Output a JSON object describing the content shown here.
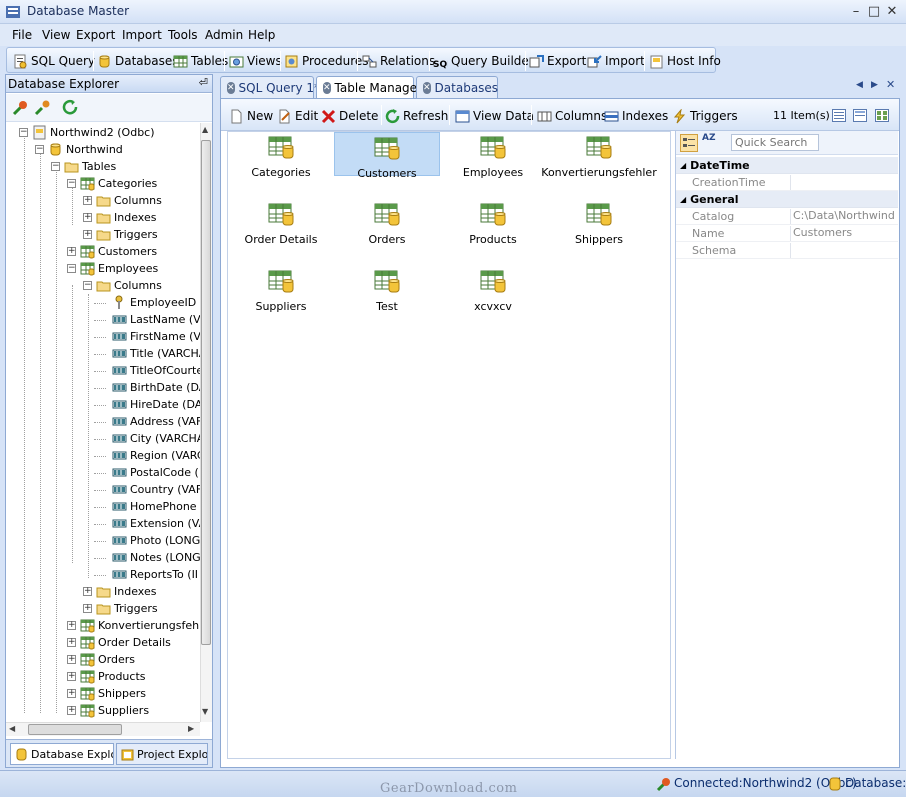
{
  "window": {
    "title": "Database Master"
  },
  "menu": [
    "File",
    "View",
    "Export",
    "Import",
    "Tools",
    "Admin",
    "Help"
  ],
  "toolbar": {
    "sql_query": "SQL Query",
    "databases": "Databases",
    "tables": "Tables",
    "views": "Views",
    "procedures": "Procedures",
    "relations": "Relations",
    "query_builder": "Query Builder",
    "export": "Export",
    "import": "Import",
    "host_info": "Host Info"
  },
  "explorer": {
    "title": "Database Explorer",
    "tree": [
      {
        "label": "Northwind2 (Odbc)",
        "icon": "connection-icon",
        "level": 0,
        "expander": "minus"
      },
      {
        "label": "Northwind",
        "icon": "database-icon",
        "level": 1,
        "expander": "minus"
      },
      {
        "label": "Tables",
        "icon": "folder-icon",
        "level": 2,
        "expander": "minus"
      },
      {
        "label": "Categories",
        "icon": "table-icon",
        "level": 3,
        "expander": "minus"
      },
      {
        "label": "Columns",
        "icon": "folder-icon",
        "level": 4,
        "expander": "plus"
      },
      {
        "label": "Indexes",
        "icon": "folder-icon",
        "level": 4,
        "expander": "plus"
      },
      {
        "label": "Triggers",
        "icon": "folder-icon",
        "level": 4,
        "expander": "plus"
      },
      {
        "label": "Customers",
        "icon": "table-icon",
        "level": 3,
        "expander": "plus"
      },
      {
        "label": "Employees",
        "icon": "table-icon",
        "level": 3,
        "expander": "minus"
      },
      {
        "label": "Columns",
        "icon": "folder-icon",
        "level": 4,
        "expander": "minus"
      },
      {
        "label": "EmployeeID (",
        "icon": "key-icon",
        "level": 5,
        "expander": ""
      },
      {
        "label": "LastName (VA",
        "icon": "column-icon",
        "level": 5,
        "expander": ""
      },
      {
        "label": "FirstName (VA",
        "icon": "column-icon",
        "level": 5,
        "expander": ""
      },
      {
        "label": "Title (VARCHA",
        "icon": "column-icon",
        "level": 5,
        "expander": ""
      },
      {
        "label": "TitleOfCourte",
        "icon": "column-icon",
        "level": 5,
        "expander": ""
      },
      {
        "label": "BirthDate (DA",
        "icon": "column-icon",
        "level": 5,
        "expander": ""
      },
      {
        "label": "HireDate (DA",
        "icon": "column-icon",
        "level": 5,
        "expander": ""
      },
      {
        "label": "Address (VAF",
        "icon": "column-icon",
        "level": 5,
        "expander": ""
      },
      {
        "label": "City (VARCHA",
        "icon": "column-icon",
        "level": 5,
        "expander": ""
      },
      {
        "label": "Region (VARC",
        "icon": "column-icon",
        "level": 5,
        "expander": ""
      },
      {
        "label": "PostalCode (",
        "icon": "column-icon",
        "level": 5,
        "expander": ""
      },
      {
        "label": "Country (VAF",
        "icon": "column-icon",
        "level": 5,
        "expander": ""
      },
      {
        "label": "HomePhone (",
        "icon": "column-icon",
        "level": 5,
        "expander": ""
      },
      {
        "label": "Extension (VA",
        "icon": "column-icon",
        "level": 5,
        "expander": ""
      },
      {
        "label": "Photo (LONG",
        "icon": "column-icon",
        "level": 5,
        "expander": ""
      },
      {
        "label": "Notes (LONG",
        "icon": "column-icon",
        "level": 5,
        "expander": ""
      },
      {
        "label": "ReportsTo (II",
        "icon": "column-icon",
        "level": 5,
        "expander": ""
      },
      {
        "label": "Indexes",
        "icon": "folder-icon",
        "level": 4,
        "expander": "plus"
      },
      {
        "label": "Triggers",
        "icon": "folder-icon",
        "level": 4,
        "expander": "plus"
      },
      {
        "label": "Konvertierungsfehler",
        "icon": "table-icon",
        "level": 3,
        "expander": "plus"
      },
      {
        "label": "Order Details",
        "icon": "table-icon",
        "level": 3,
        "expander": "plus"
      },
      {
        "label": "Orders",
        "icon": "table-icon",
        "level": 3,
        "expander": "plus"
      },
      {
        "label": "Products",
        "icon": "table-icon",
        "level": 3,
        "expander": "plus"
      },
      {
        "label": "Shippers",
        "icon": "table-icon",
        "level": 3,
        "expander": "plus"
      },
      {
        "label": "Suppliers",
        "icon": "table-icon",
        "level": 3,
        "expander": "plus"
      }
    ],
    "bottom_tabs": [
      "Database Explo...",
      "Project Explo..."
    ]
  },
  "doc_tabs": [
    {
      "label": "SQL Query 1*",
      "active": false
    },
    {
      "label": "Table Manager",
      "active": true
    },
    {
      "label": "Databases",
      "active": false
    }
  ],
  "table_manager": {
    "toolbar": {
      "new": "New",
      "edit": "Edit",
      "delete": "Delete",
      "refresh": "Refresh",
      "view_data": "View Data",
      "columns": "Columns",
      "indexes": "Indexes",
      "triggers": "Triggers",
      "item_count": "11 Item(s)"
    },
    "selected": "Customers",
    "tables": [
      "Categories",
      "Customers",
      "Employees",
      "Konvertierungsfehler",
      "Order Details",
      "Orders",
      "Products",
      "Shippers",
      "Suppliers",
      "Test",
      "xcvxcv"
    ]
  },
  "properties": {
    "search_placeholder": "Quick Search",
    "sort_label": "AZ",
    "categories": [
      {
        "name": "DateTime",
        "rows": [
          {
            "name": "CreationTime",
            "value": ""
          }
        ]
      },
      {
        "name": "General",
        "rows": [
          {
            "name": "Catalog",
            "value": "C:\\Data\\Northwind"
          },
          {
            "name": "Name",
            "value": "Customers"
          },
          {
            "name": "Schema",
            "value": ""
          }
        ]
      }
    ]
  },
  "status": {
    "connection": "Connected:Northwind2 (Odbc)",
    "database": "Database:"
  },
  "watermark": "GearDownload.com",
  "colors": {
    "accent": "#1e3a78",
    "selection": "#c3dcf6",
    "frame": "#d6e3f7"
  }
}
